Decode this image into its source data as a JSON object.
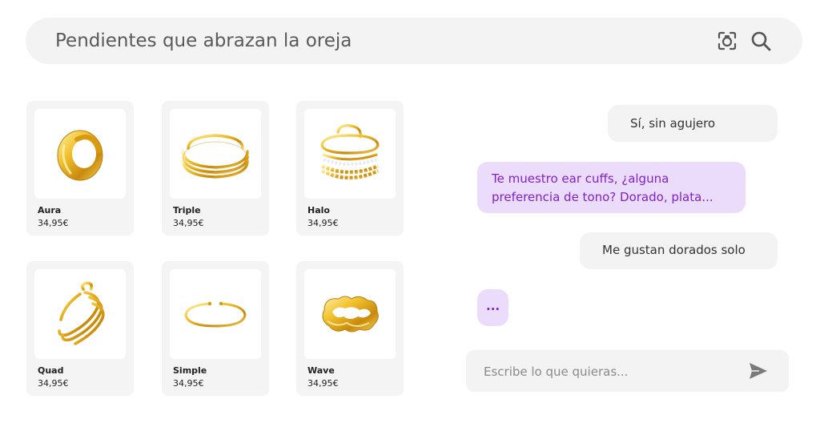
{
  "search": {
    "query": "Pendientes que abrazan la oreja",
    "camera_icon": "camera-search-icon",
    "search_icon": "magnifier-icon"
  },
  "products": [
    {
      "name": "Aura",
      "price": "34,95€"
    },
    {
      "name": "Triple",
      "price": "34,95€"
    },
    {
      "name": "Halo",
      "price": "34,95€"
    },
    {
      "name": "Quad",
      "price": "34,95€"
    },
    {
      "name": "Simple",
      "price": "34,95€"
    },
    {
      "name": "Wave",
      "price": "34,95€"
    }
  ],
  "chat": {
    "messages": [
      {
        "role": "user",
        "text": "Sí, sin agujero"
      },
      {
        "role": "assistant",
        "text": "Te muestro ear cuffs, ¿alguna preferencia de tono? Dorado, plata..."
      },
      {
        "role": "user",
        "text": "Me gustan dorados solo"
      },
      {
        "role": "assistant",
        "text": "..."
      }
    ],
    "input_placeholder": "Escribe lo que quieras...",
    "send_icon": "send-icon"
  },
  "colors": {
    "gold": "#e0a818",
    "bot_bubble": "#ecdcfc",
    "bot_text": "#7e22ce",
    "panel_gray": "#f3f3f3"
  }
}
